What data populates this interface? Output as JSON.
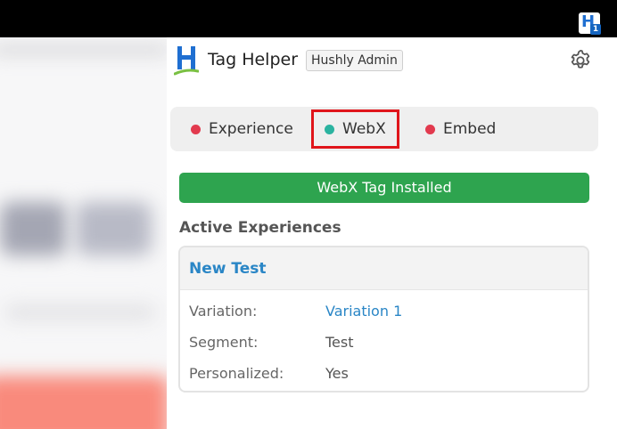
{
  "app": {
    "title": "Tag Helper",
    "badge": "Hushly Admin",
    "logo_letter": "H",
    "extension_badge": "1"
  },
  "tabs": [
    {
      "label": "Experience",
      "dot_color": "#e23a4e",
      "active": false
    },
    {
      "label": "WebX",
      "dot_color": "#2bb3a0",
      "active": true
    },
    {
      "label": "Embed",
      "dot_color": "#e23a4e",
      "active": false
    }
  ],
  "status": {
    "label": "WebX Tag Installed",
    "color": "#2ea44f"
  },
  "active_experiences": {
    "heading": "Active Experiences",
    "items": [
      {
        "name": "New Test",
        "fields": [
          {
            "label": "Variation:",
            "value": "Variation 1",
            "is_link": true
          },
          {
            "label": "Segment:",
            "value": "Test",
            "is_link": false
          },
          {
            "label": "Personalized:",
            "value": "Yes",
            "is_link": false
          }
        ]
      }
    ]
  },
  "icons": {
    "settings": "gear-icon",
    "extension": "hushly-extension-icon",
    "logo": "hushly-logo-icon"
  },
  "colors": {
    "accent": "#2a86c6",
    "active_tab_border": "#e0151b"
  }
}
